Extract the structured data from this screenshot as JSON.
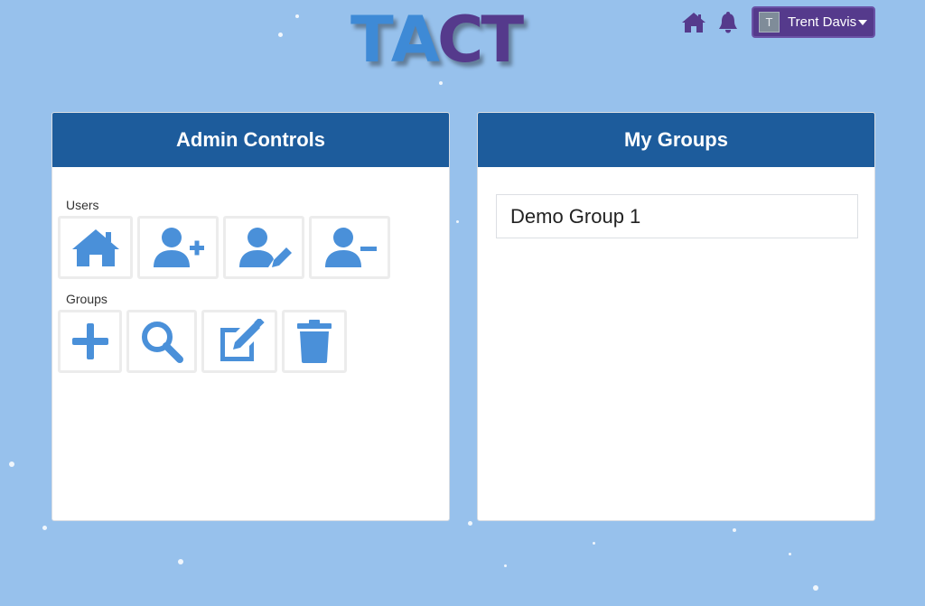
{
  "app": {
    "logo_letters": [
      "T",
      "A",
      "C",
      "T"
    ],
    "colors": {
      "background": "#97c1ec",
      "header": "#1d5c9c",
      "accent": "#553a8c",
      "icon": "#4a90d9"
    }
  },
  "topnav": {
    "home_icon": "home-icon",
    "bell_icon": "bell-icon",
    "user": {
      "avatar_initial": "T",
      "name": "Trent Davis"
    }
  },
  "admin_panel": {
    "title": "Admin Controls",
    "users_label": "Users",
    "users_actions": [
      "home-icon",
      "user-plus-icon",
      "user-edit-icon",
      "user-minus-icon"
    ],
    "groups_label": "Groups",
    "groups_actions": [
      "plus-icon",
      "search-icon",
      "edit-icon",
      "trash-icon"
    ]
  },
  "groups_panel": {
    "title": "My Groups",
    "groups": [
      "Demo Group 1"
    ]
  }
}
